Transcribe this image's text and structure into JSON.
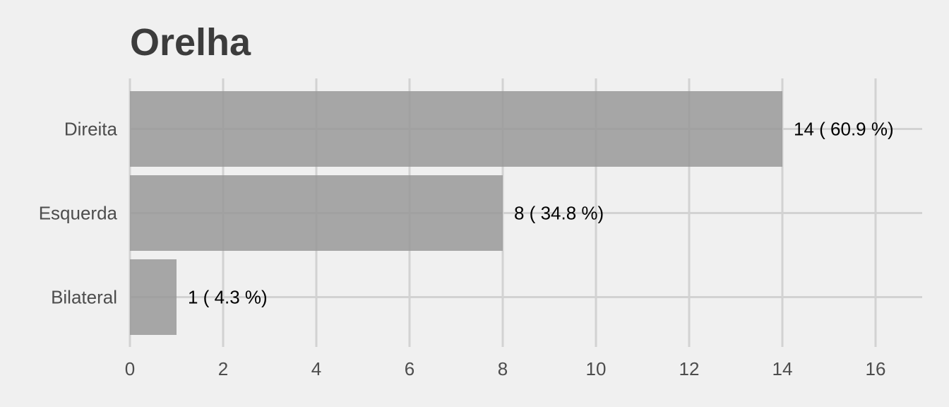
{
  "chart_data": {
    "type": "bar",
    "orientation": "horizontal",
    "title": "Orelha",
    "xlabel": "",
    "ylabel": "",
    "categories": [
      "Direita",
      "Esquerda",
      "Bilateral"
    ],
    "values": [
      14,
      8,
      1
    ],
    "data_labels": [
      "14 ( 60.9 %)",
      "8 ( 34.8 %)",
      "1 ( 4.3 %)"
    ],
    "xlim": [
      0,
      17
    ],
    "x_ticks": [
      0,
      2,
      4,
      6,
      8,
      10,
      12,
      14,
      16
    ],
    "x_tick_labels": [
      "0",
      "2",
      "4",
      "6",
      "8",
      "10",
      "12",
      "14",
      "16"
    ],
    "grid": true,
    "legend": "none",
    "colors": {
      "background": "#f0f0f0",
      "bar": "#999999",
      "grid": "#d2d2d2",
      "title": "#3c3c3c",
      "tick_text": "#4d4d4d",
      "data_label_text": "#000000"
    }
  }
}
